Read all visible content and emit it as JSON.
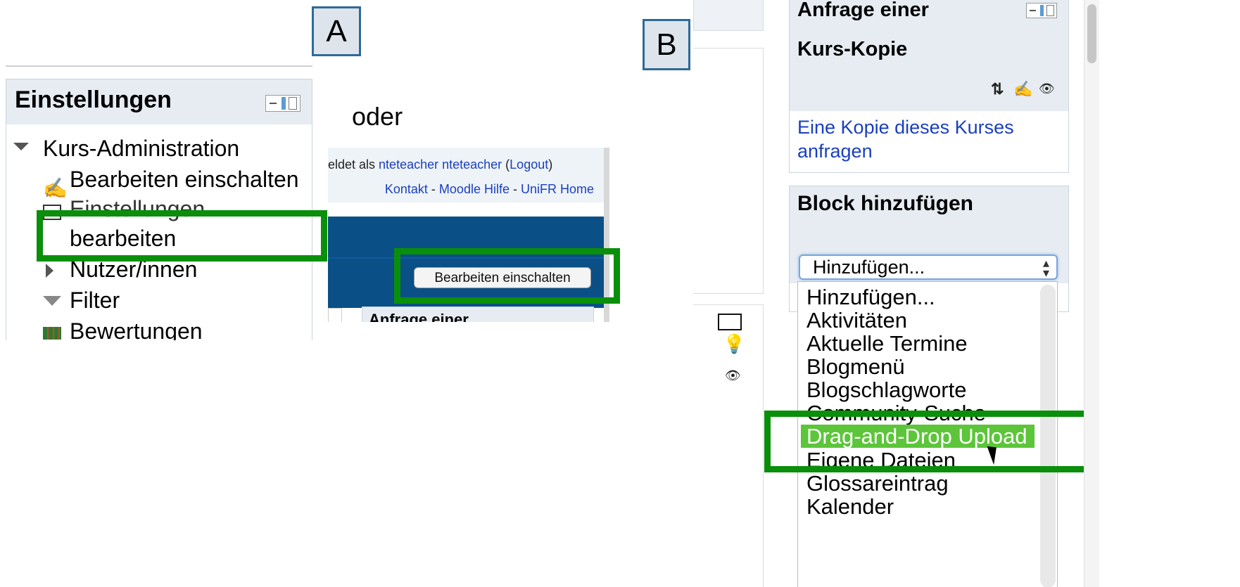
{
  "labels": {
    "a": "A",
    "b": "B",
    "oder": "oder"
  },
  "panel_a": {
    "block_title": "Einstellungen",
    "items": {
      "kurs_admin": "Kurs-Administration",
      "edit_on": "Bearbeiten einschalten",
      "settings_line1": "Einstellungen",
      "settings_line2": "bearbeiten",
      "users": "Nutzer/innen",
      "filter": "Filter",
      "grades": "Bewertungen"
    }
  },
  "header_snippet": {
    "logged_prefix": "eldet als ",
    "user": "nteteacher nteteacher",
    "logout_open": " (",
    "logout": "Logout",
    "logout_close": ")",
    "contact": "Kontakt",
    "sep": " - ",
    "help": "Moodle Hilfe",
    "home": "UniFR Home",
    "edit_button": "Bearbeiten einschalten",
    "block_peek": "Anfrage einer"
  },
  "panel_b": {
    "copy_block": {
      "title_line1": "Anfrage einer",
      "title_line2": "Kurs-Kopie",
      "link_line1": "Eine Kopie dieses Kurses",
      "link_line2": "anfragen"
    },
    "add_block": {
      "title": "Block hinzufügen",
      "select_value": "Hinzufügen...",
      "options": [
        "Hinzufügen...",
        "Aktivitäten",
        "Aktuelle Termine",
        "Blogmenü",
        "Blogschlagworte",
        "Community-Suche",
        "Drag-and-Drop Upload",
        "Eigene Dateien",
        "Glossareintrag",
        "Kalender"
      ],
      "highlighted_option": "Drag-and-Drop Upload"
    }
  },
  "colors": {
    "highlight_border": "#0a8f0a",
    "menu_selected": "#5cc53a",
    "moodle_blue": "#0a4f86",
    "link": "#1a3fbf"
  }
}
